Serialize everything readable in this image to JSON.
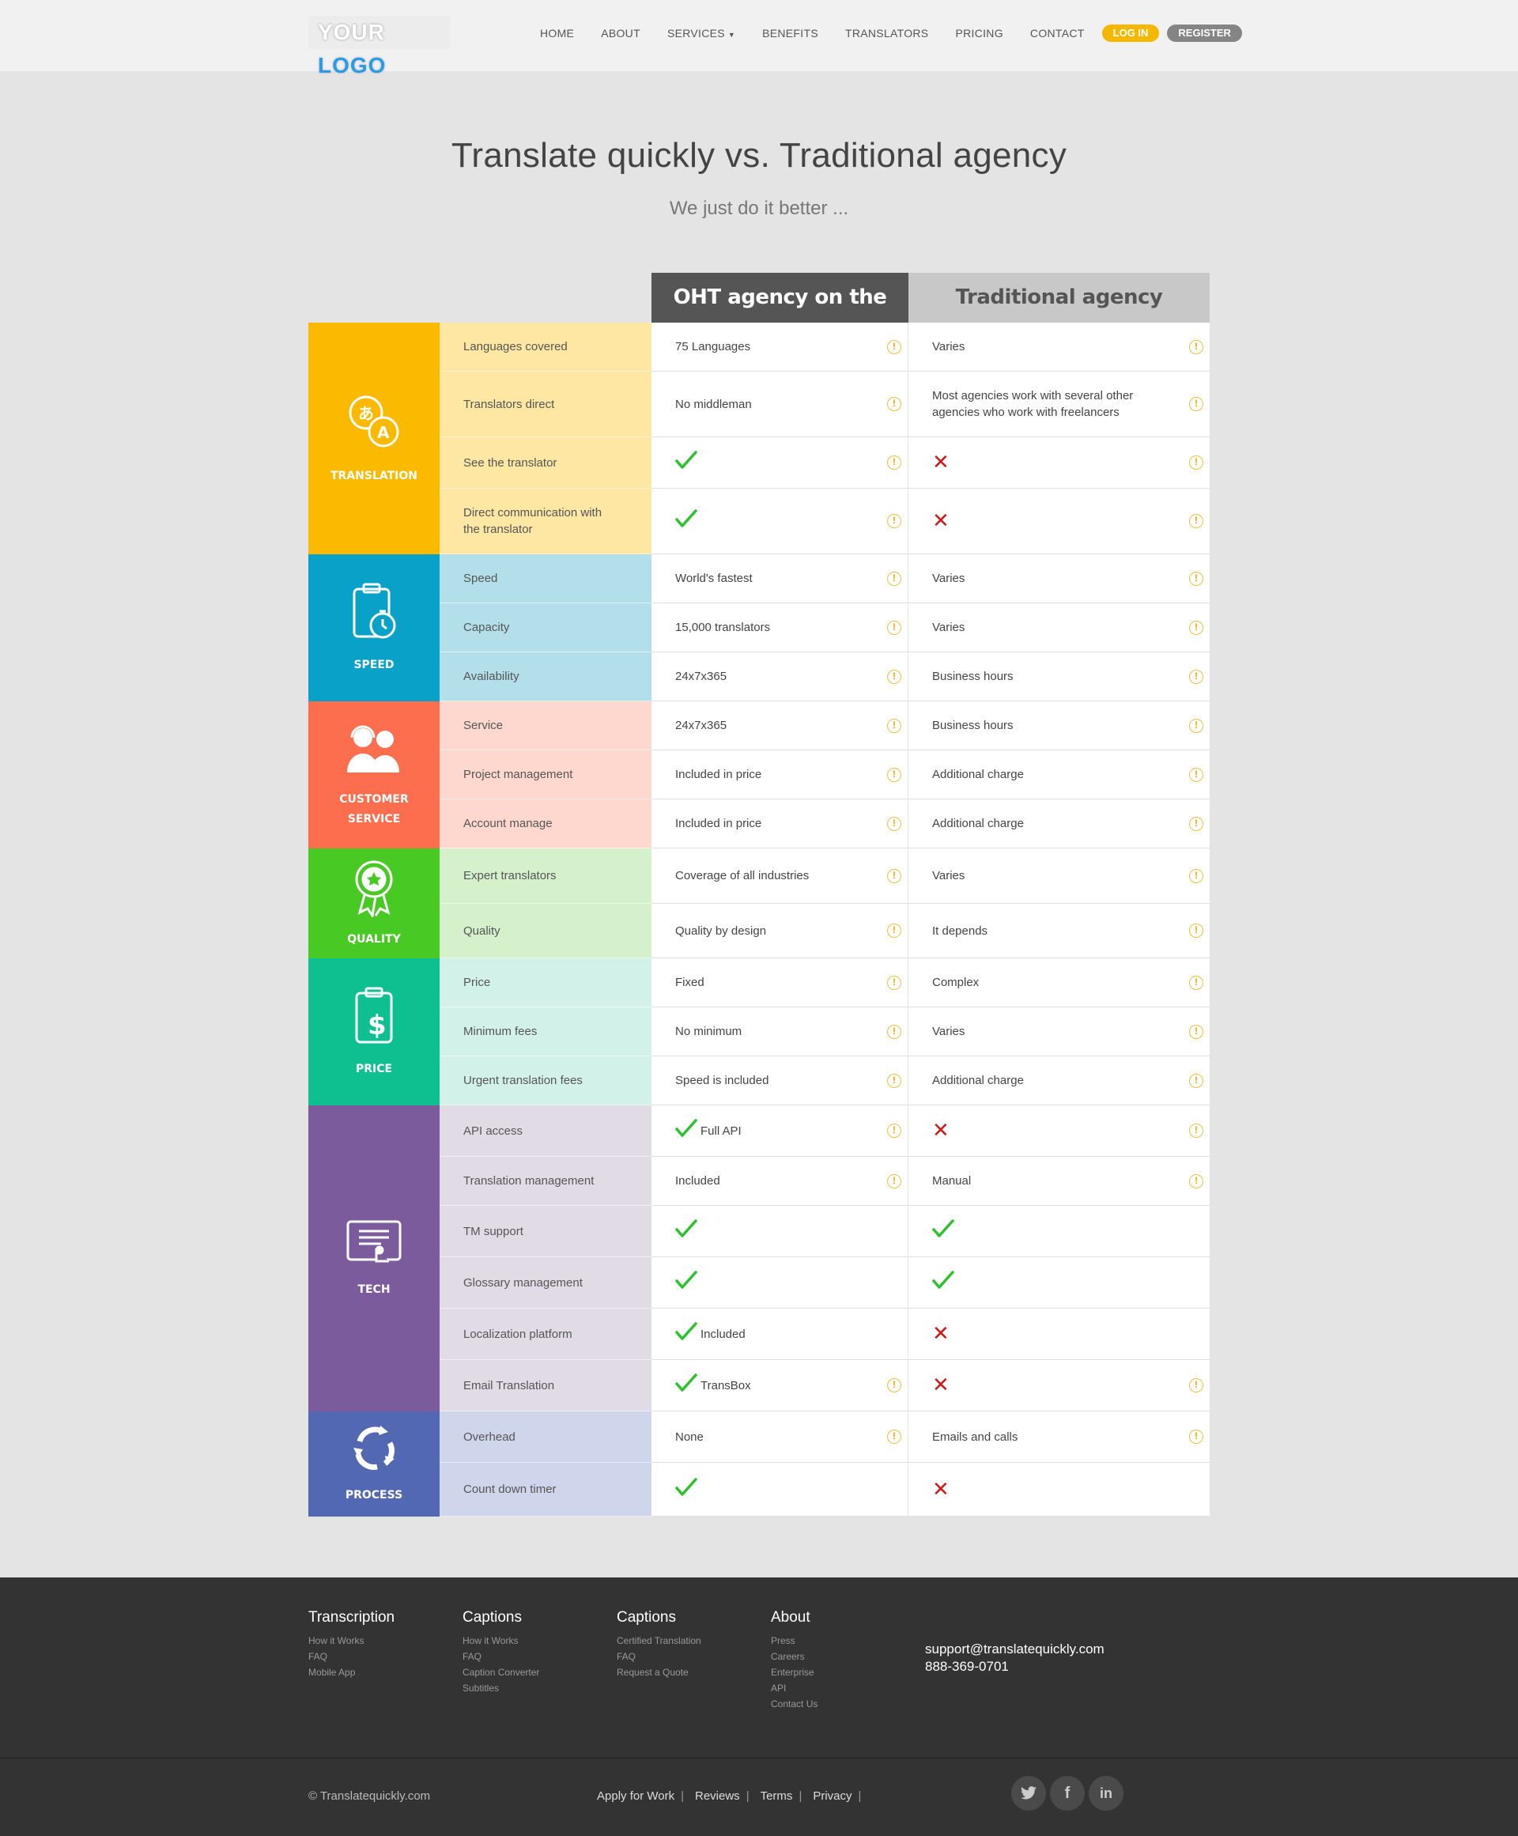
{
  "header": {
    "logo_part1": "YOUR",
    "logo_part2": "LOGO",
    "nav": [
      "HOME",
      "ABOUT",
      "SERVICES",
      "BENEFITS",
      "TRANSLATORS",
      "PRICING",
      "CONTACT"
    ],
    "login": "LOG IN",
    "register": "REGISTER"
  },
  "hero": {
    "title": "Translate quickly vs. Traditional agency",
    "subtitle": "We just do it better ..."
  },
  "table": {
    "col_oht": "OHT agency on the web",
    "col_trad": "Traditional agency",
    "groups": [
      {
        "name": "TRANSLATION",
        "rows": [
          {
            "feature": "Languages covered",
            "oht": "75 Languages",
            "trad": "Varies"
          },
          {
            "feature": "Translators direct",
            "oht": "No middleman",
            "trad": "Most agencies work with several other agencies who work with freelancers"
          },
          {
            "feature": "See the translator",
            "oht": "",
            "trad": ""
          },
          {
            "feature": "Direct communication with the translator",
            "oht": "",
            "trad": ""
          }
        ]
      },
      {
        "name": "SPEED",
        "rows": [
          {
            "feature": "Speed",
            "oht": "World's fastest",
            "trad": "Varies"
          },
          {
            "feature": "Capacity",
            "oht": "15,000 translators",
            "trad": "Varies"
          },
          {
            "feature": "Availability",
            "oht": "24x7x365",
            "trad": "Business hours"
          }
        ]
      },
      {
        "name": "CUSTOMER SERVICE",
        "rows": [
          {
            "feature": "Service",
            "oht": "24x7x365",
            "trad": "Business hours"
          },
          {
            "feature": "Project management",
            "oht": "Included in price",
            "trad": "Additional charge"
          },
          {
            "feature": "Account manage",
            "oht": "Included in price",
            "trad": "Additional charge"
          }
        ]
      },
      {
        "name": "QUALITY",
        "rows": [
          {
            "feature": "Expert translators",
            "oht": "Coverage of all industries",
            "trad": "Varies"
          },
          {
            "feature": "Quality",
            "oht": "Quality by design",
            "trad": "It depends"
          }
        ]
      },
      {
        "name": "PRICE",
        "rows": [
          {
            "feature": "Price",
            "oht": "Fixed",
            "trad": "Complex"
          },
          {
            "feature": "Minimum fees",
            "oht": "No minimum",
            "trad": "Varies"
          },
          {
            "feature": "Urgent translation fees",
            "oht": "Speed is included",
            "trad": "Additional charge"
          }
        ]
      },
      {
        "name": "TECH",
        "rows": [
          {
            "feature": "API access",
            "oht": "Full API",
            "trad": ""
          },
          {
            "feature": "Translation management",
            "oht": "Included",
            "trad": "Manual"
          },
          {
            "feature": "TM support",
            "oht": "",
            "trad": ""
          },
          {
            "feature": "Glossary management",
            "oht": "",
            "trad": ""
          },
          {
            "feature": "Localization platform",
            "oht": "Included",
            "trad": ""
          },
          {
            "feature": "Email Translation",
            "oht": "TransBox",
            "trad": ""
          }
        ]
      },
      {
        "name": "PROCESS",
        "rows": [
          {
            "feature": "Overhead",
            "oht": "None",
            "trad": "Emails and calls"
          },
          {
            "feature": "Count down timer",
            "oht": "",
            "trad": ""
          }
        ]
      }
    ]
  },
  "footer": {
    "cols": [
      {
        "title": "Transcription",
        "links": [
          "How it Works",
          "FAQ",
          "Mobile App"
        ]
      },
      {
        "title": "Captions",
        "links": [
          "How it Works",
          "FAQ",
          "Caption Converter",
          "Subtitles"
        ]
      },
      {
        "title": "Captions",
        "links": [
          "Certified Translation",
          "FAQ",
          "Request a Quote"
        ]
      },
      {
        "title": "About",
        "links": [
          "Press",
          "Careers",
          "Enterprise",
          "API",
          "Contact Us"
        ]
      }
    ],
    "email": "support@translatequickly.com",
    "phone": "888-369-0701",
    "copyright": "© Translatequickly.com",
    "bottom_links": [
      "Apply for Work",
      "Reviews",
      "Terms",
      "Privacy"
    ]
  }
}
